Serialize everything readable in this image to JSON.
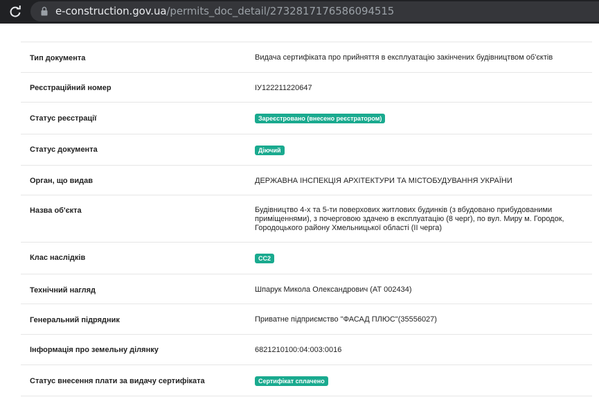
{
  "browser": {
    "url_host": "e-construction.gov.ua",
    "url_path": "/permits_doc_detail/2732817176586094515"
  },
  "page": {
    "rows": [
      {
        "label": "Тип документа",
        "value": "Видача сертифіката про прийняття в експлуатацію закінчених будівництвом об'єктів"
      },
      {
        "label": "Реєстраційний номер",
        "value": "ІУ122211220647"
      },
      {
        "label": "Статус реєстрації",
        "badge": "Зареєстровано (внесено реєстратором)"
      },
      {
        "label": "Статус документа",
        "badge": "Діючий"
      },
      {
        "label": "Орган, що видав",
        "value": "ДЕРЖАВНА ІНСПЕКЦІЯ АРХІТЕКТУРИ ТА МІСТОБУДУВАННЯ УКРАЇНИ"
      },
      {
        "label": "Назва об'єкта",
        "value": "Будівництво 4-х та 5-ти поверхових житлових будинків (з вбудовано прибудованими приміщеннями), з почерговою здачею в експлуатацію (8 черг), по вул. Миру м. Городок, Городоцького району Хмельницької області (ІІ черга)"
      },
      {
        "label": "Клас наслідків",
        "badge": "СС2"
      },
      {
        "label": "Технічний нагляд",
        "value": "Шпарук Микола Олександрович (АТ 002434)"
      },
      {
        "label": "Генеральний підрядник",
        "value": "Приватне підприємство \"ФАСАД ПЛЮС\"(35556027)"
      },
      {
        "label": "Інформація про земельну ділянку",
        "value": "6821210100:04:003:0016"
      },
      {
        "label": "Статус внесення плати за видачу сертифіката",
        "badge": "Сертифікат сплачено"
      }
    ]
  },
  "colors": {
    "badge": "#1aaa8f",
    "browser_bar": "#202124"
  }
}
